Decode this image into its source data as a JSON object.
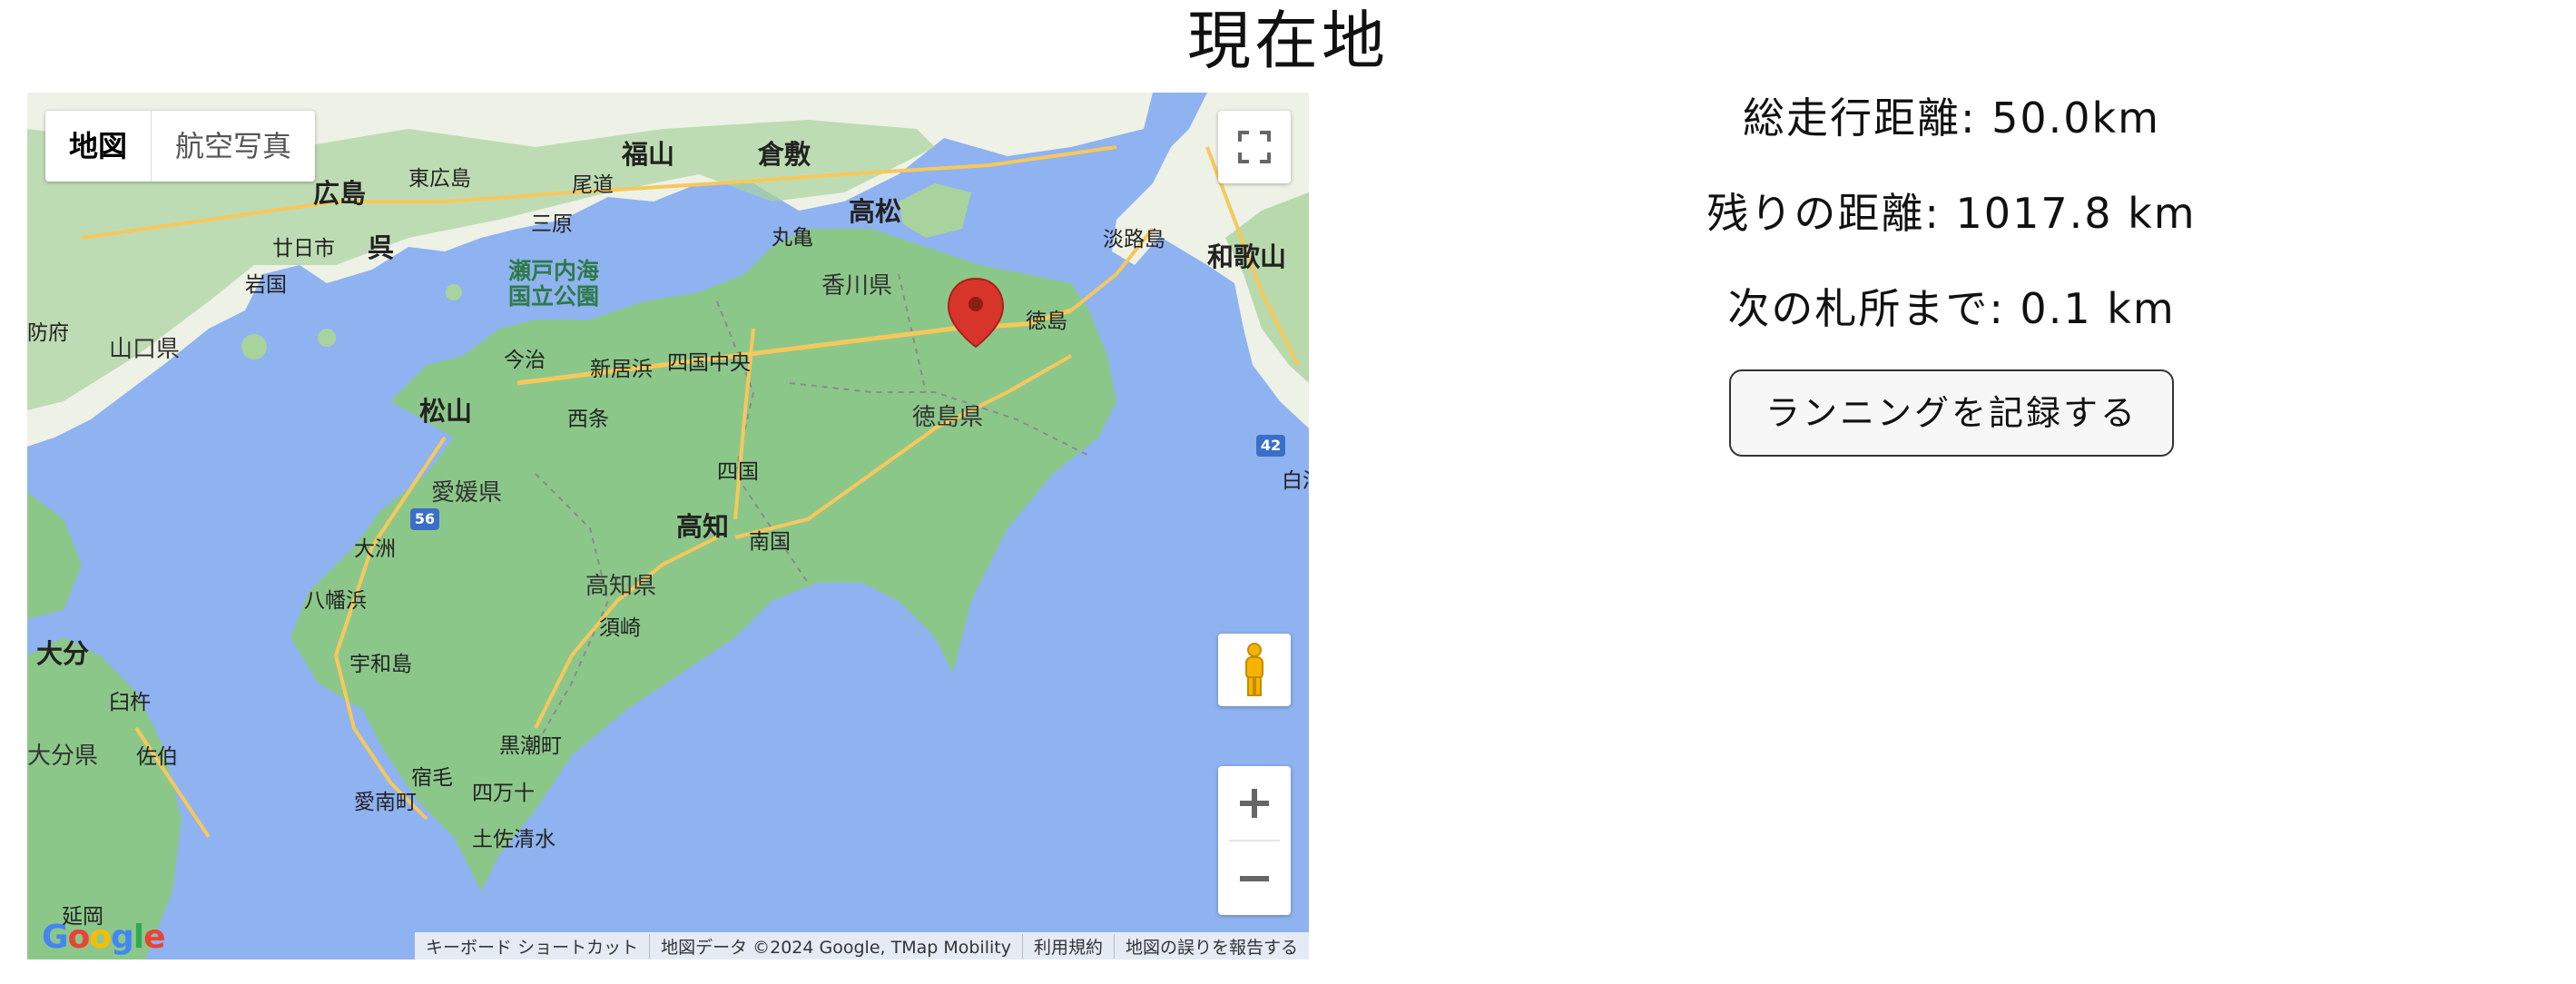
{
  "title": "現在地",
  "map": {
    "type_options": [
      "地図",
      "航空写真"
    ],
    "selected_type": "地図",
    "labels": {
      "fukuyama": "福山",
      "kurashiki": "倉敷",
      "higashihiroshima": "東広島",
      "onomichi": "尾道",
      "hiroshima": "広島",
      "mihara": "三原",
      "hatsukaichi": "廿日市",
      "kure": "呉",
      "iwakuni": "岩国",
      "hofu": "防府",
      "yamaguchi_pref": "山口県",
      "takamatsu": "高松",
      "marugame": "丸亀",
      "kagawa_pref": "香川県",
      "awajishima": "淡路島",
      "wakayama": "和歌山",
      "tokushima": "徳島",
      "imabari": "今治",
      "niihama": "新居浜",
      "shikokuchuo": "四国中央",
      "matsuyama": "松山",
      "saijo": "西条",
      "tokushima_pref": "徳島県",
      "shikoku": "四国",
      "ehime_pref": "愛媛県",
      "kochi": "高知",
      "nankoku": "南国",
      "ozu": "大洲",
      "yawatahama": "八幡浜",
      "kochi_pref": "高知県",
      "susaki": "須崎",
      "oita": "大分",
      "usuki": "臼杵",
      "uwajima": "宇和島",
      "oita_pref": "大分県",
      "saiki": "佐伯",
      "kuroshio": "黒潮町",
      "sukumo": "宿毛",
      "shimanto": "四万十",
      "ainan": "愛南町",
      "tosashimizu": "土佐清水",
      "nobeoka": "延岡",
      "shirahama": "白浜",
      "park_line1": "瀬戸内海",
      "park_line2": "国立公園",
      "route_56": "56",
      "route_42": "42"
    },
    "attribution": [
      "キーボード ショートカット",
      "地図データ ©2024 Google, TMap Mobility",
      "利用規約",
      "地図の誤りを報告する"
    ],
    "logo": "Google",
    "colors": {
      "water": "#8fb2f0",
      "land_green": "#8cc78a",
      "land_light": "#eef1e6",
      "road": "#f6c85c",
      "marker": "#d7352b"
    }
  },
  "stats": {
    "total_distance": "総走行距離: 50.0km",
    "remaining_distance": "残りの距離: 1017.8 km",
    "next_temple": "次の札所まで: 0.1 km"
  },
  "record_button": "ランニングを記録する"
}
